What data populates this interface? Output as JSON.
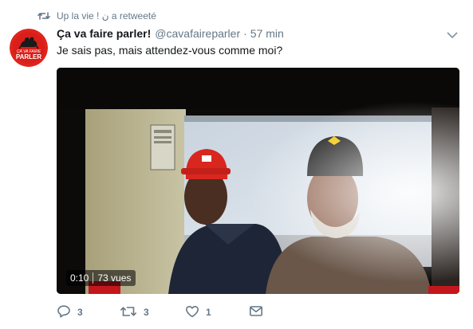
{
  "retweet_context": {
    "text": "Up la vie ! ن a retweeté",
    "icon": "retweet-icon"
  },
  "author": {
    "fullname": "Ça va faire parler!",
    "username": "@cavafaireparler",
    "separator": "·",
    "time": "57 min",
    "avatar_line1": "ÇA VA FAIRE",
    "avatar_line2": "PARLER",
    "avatar_color": "#e0241d"
  },
  "tweet": {
    "text": "Je sais pas, mais attendez-vous comme moi?"
  },
  "media": {
    "elapsed": "0:10",
    "views": "73 vues"
  },
  "actions": {
    "reply_count": "3",
    "retweet_count": "3",
    "like_count": "1"
  },
  "colors": {
    "secondary_text": "#657786",
    "primary_text": "#14171a"
  }
}
